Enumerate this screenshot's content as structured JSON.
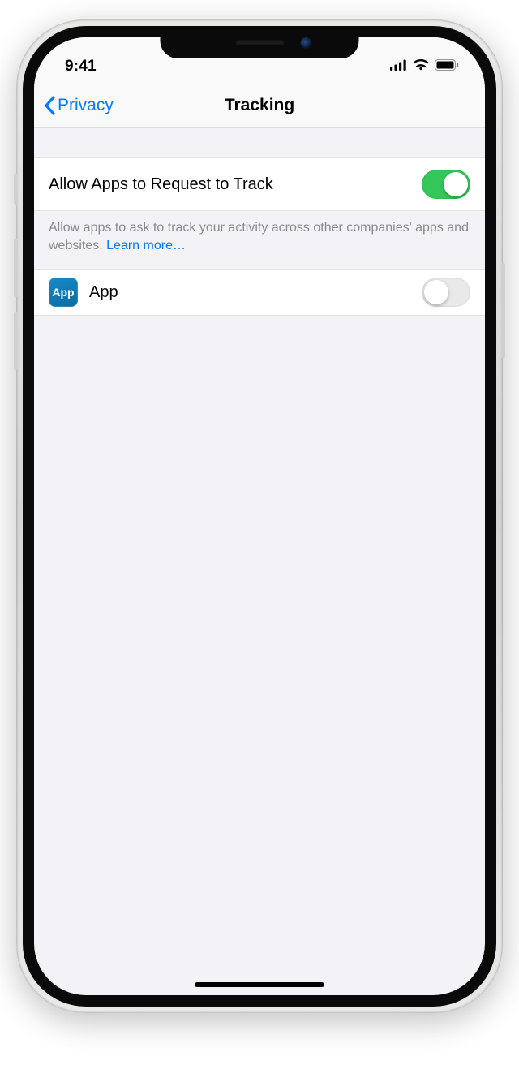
{
  "status": {
    "time": "9:41"
  },
  "nav": {
    "back_label": "Privacy",
    "title": "Tracking"
  },
  "allow_row": {
    "label": "Allow Apps to Request to Track",
    "on": true
  },
  "footer": {
    "text": "Allow apps to ask to track your activity across other companies' apps and websites. ",
    "link": "Learn more…"
  },
  "app_row": {
    "icon_text": "App",
    "name": "App",
    "on": false
  }
}
